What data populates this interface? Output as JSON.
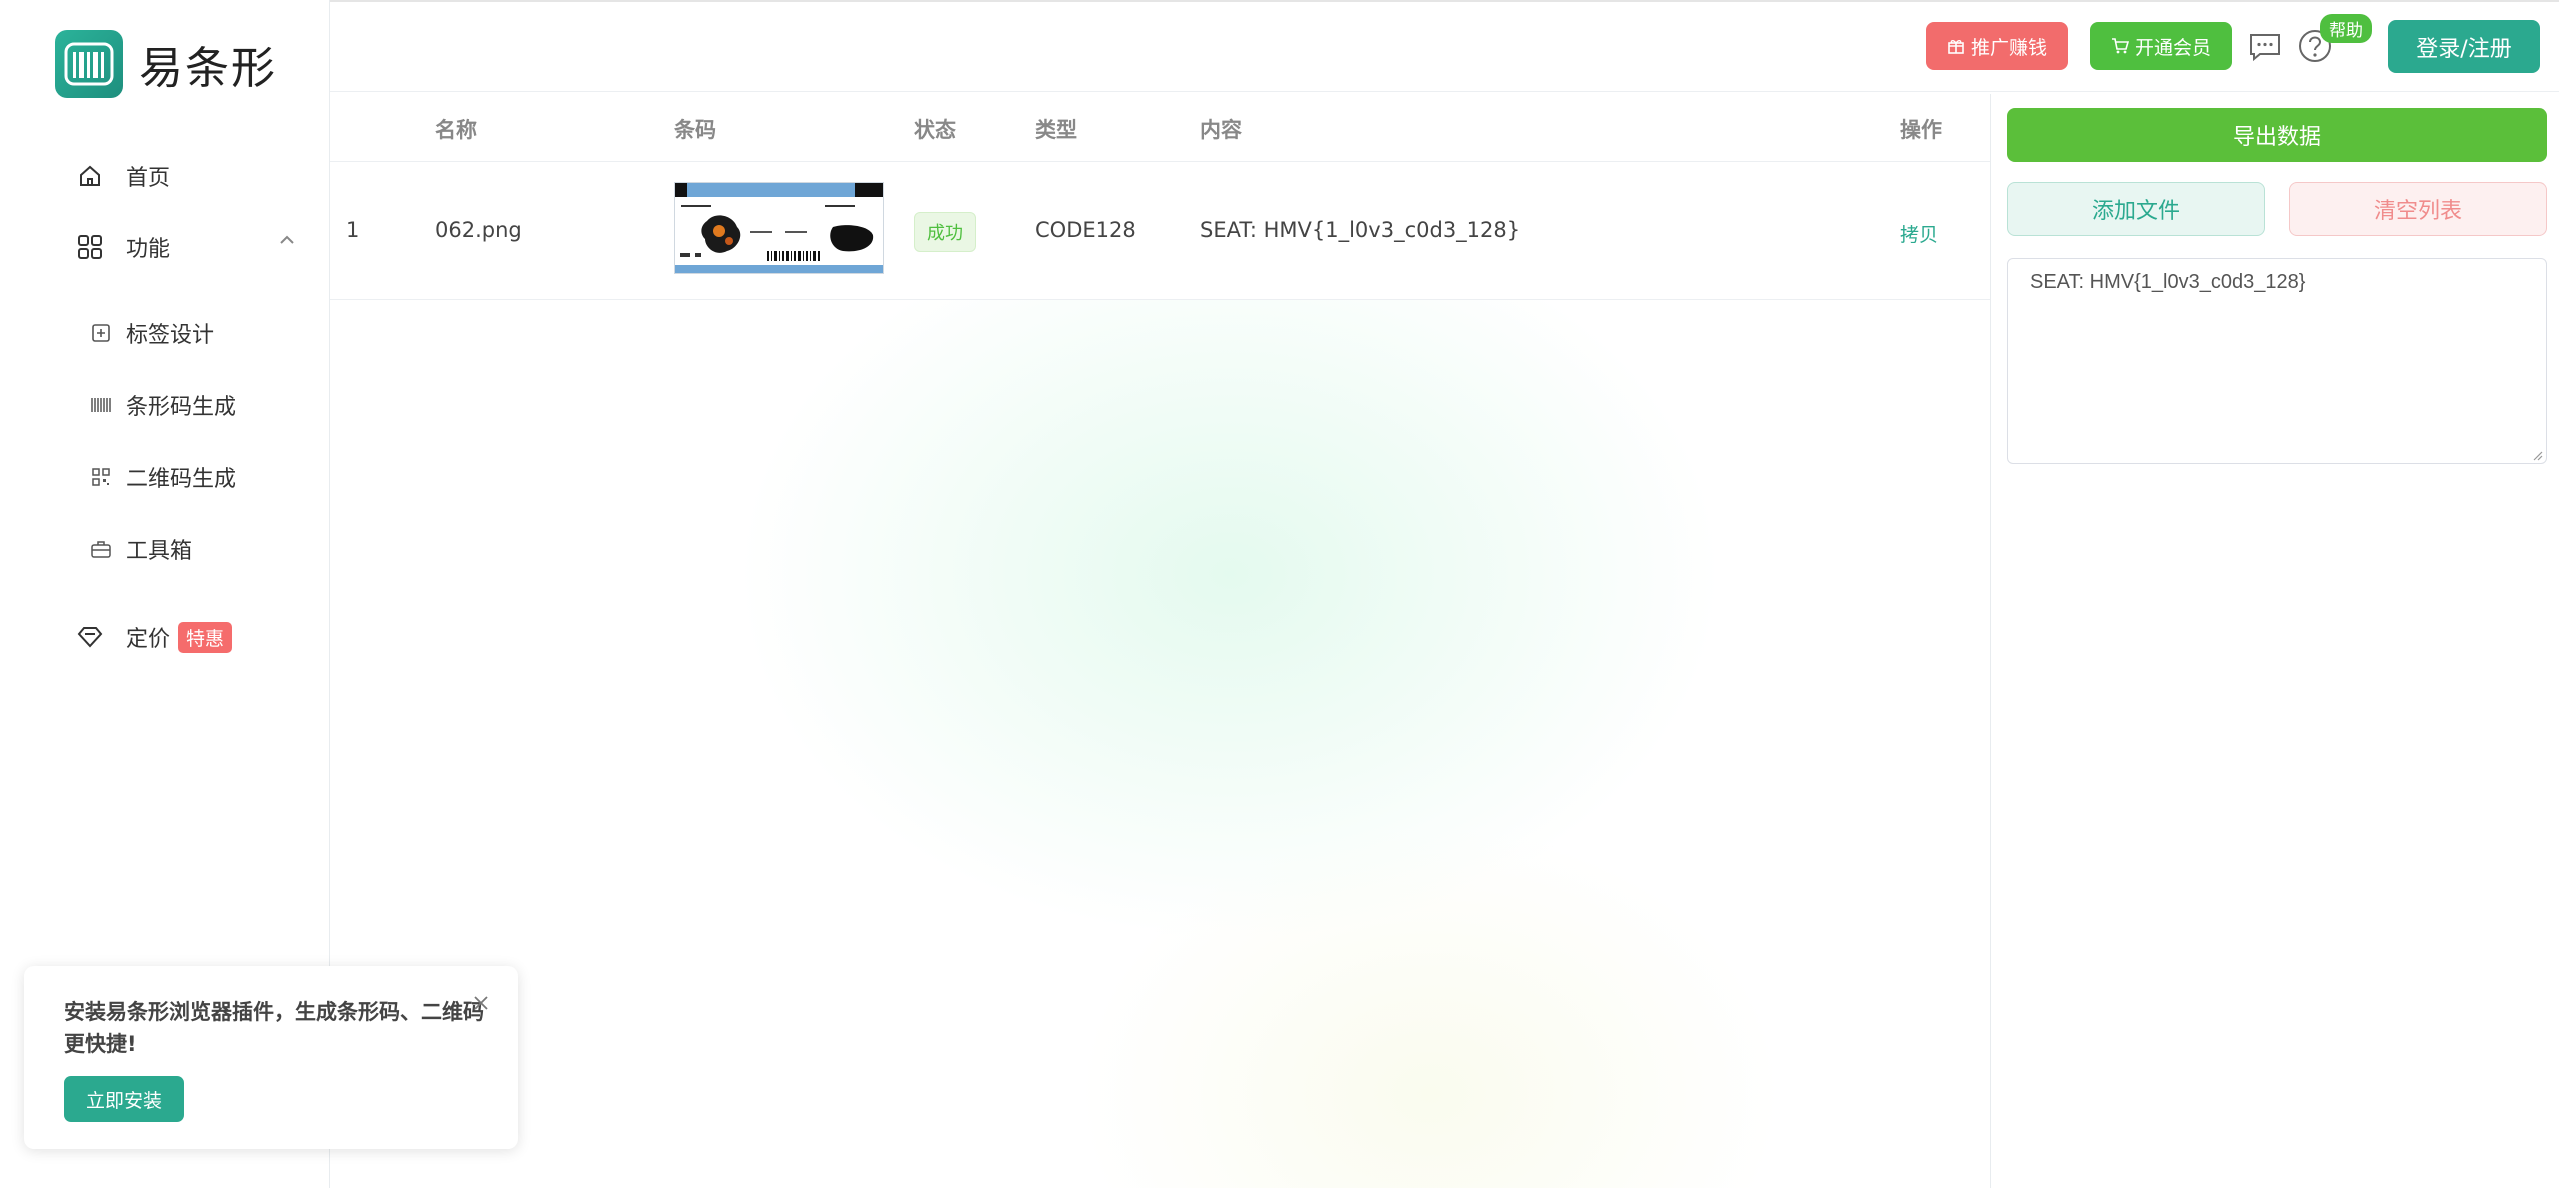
{
  "app": {
    "name": "易条形",
    "brand_color": "#2ba98f"
  },
  "sidebar": {
    "home": "首页",
    "features": "功能",
    "sub_items": [
      {
        "label": "标签设计",
        "icon": "plus-square-icon"
      },
      {
        "label": "条形码生成",
        "icon": "barcode-icon"
      },
      {
        "label": "二维码生成",
        "icon": "qrcode-icon"
      },
      {
        "label": "工具箱",
        "icon": "toolbox-icon"
      }
    ],
    "pricing": "定价",
    "pricing_badge": "特惠"
  },
  "header": {
    "promote": "推广赚钱",
    "vip": "开通会员",
    "help_badge": "帮助",
    "login": "登录/注册"
  },
  "table": {
    "columns": [
      "名称",
      "条码",
      "状态",
      "类型",
      "内容",
      "操作"
    ],
    "rows": [
      {
        "index": "1",
        "name": "062.png",
        "status": "成功",
        "type": "CODE128",
        "content": "SEAT: HMV{1_l0v3_c0d3_128}",
        "action": "拷贝"
      }
    ]
  },
  "right_panel": {
    "export": "导出数据",
    "add_file": "添加文件",
    "clear_list": "清空列表",
    "output": "SEAT: HMV{1_l0v3_c0d3_128}"
  },
  "popup": {
    "message": "安装易条形浏览器插件，生成条形码、二维码更快捷!",
    "install": "立即安装"
  }
}
